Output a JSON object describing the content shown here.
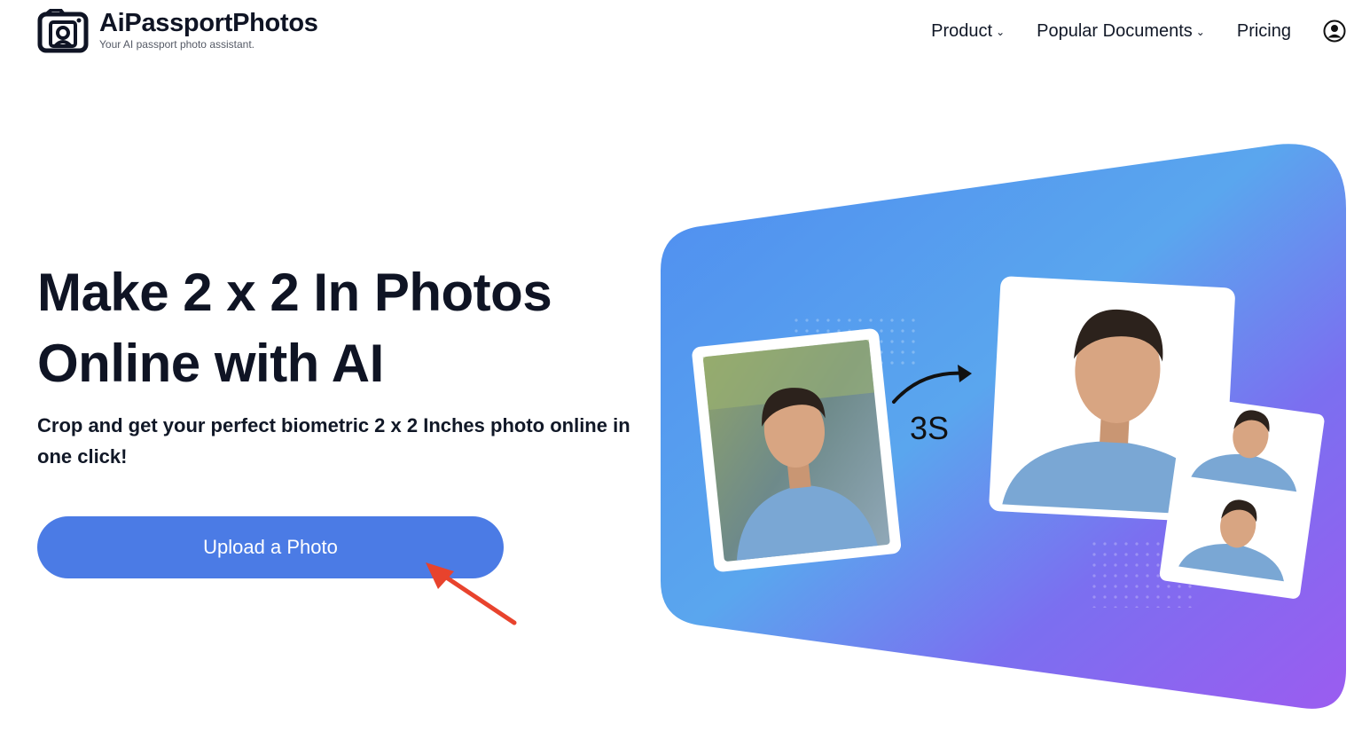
{
  "header": {
    "brand": "AiPassportPhotos",
    "tagline": "Your AI passport photo assistant.",
    "nav": [
      {
        "label": "Product",
        "has_dropdown": true
      },
      {
        "label": "Popular Documents",
        "has_dropdown": true
      },
      {
        "label": "Pricing",
        "has_dropdown": false
      }
    ],
    "user_icon": "user-circle-icon"
  },
  "hero": {
    "title_line1": "Make 2 x 2 In Photos",
    "title_line2": "Online with AI",
    "subtitle": "Crop and get your perfect biometric 2 x 2 Inches photo online in one click!",
    "upload_label": "Upload a Photo",
    "timer_label": "3S"
  },
  "colors": {
    "button": "#4b7be5",
    "annotation_arrow": "#e8432d",
    "gradient_blue": "#4f8df0",
    "gradient_purple": "#8b5cf6"
  }
}
